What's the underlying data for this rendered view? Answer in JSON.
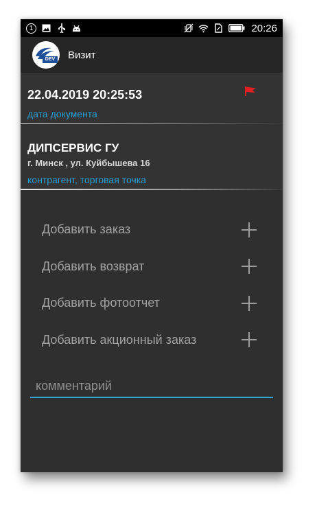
{
  "status_bar": {
    "notification_count": "1",
    "icons_left": [
      "notification-count-icon",
      "image-icon",
      "usb-icon",
      "android-debug-icon"
    ],
    "icons_right": [
      "vibrate-off-icon",
      "wifi-icon",
      "no-sim-icon",
      "battery-icon"
    ],
    "time": "20:26"
  },
  "app_bar": {
    "logo_text": "DEV",
    "title": "Визит"
  },
  "document": {
    "date": "22.04.2019 20:25:53",
    "label": "дата документа",
    "flag_icon": "flag-icon",
    "flag_color": "#e02020"
  },
  "counterparty": {
    "name": "ДИПСЕРВИС  ГУ",
    "address": "г. Минск , ул. Куйбышева 16",
    "label": "контрагент, торговая точка"
  },
  "actions": [
    {
      "label": "Добавить заказ",
      "icon": "plus-icon"
    },
    {
      "label": "Добавить возврат",
      "icon": "plus-icon"
    },
    {
      "label": "Добавить фотоотчет",
      "icon": "plus-icon"
    },
    {
      "label": "Добавить акционный заказ",
      "icon": "plus-icon"
    }
  ],
  "comment": {
    "placeholder": "комментарий",
    "value": ""
  },
  "colors": {
    "accent": "#27a0d8",
    "background": "#2f2f2f",
    "app_bar": "#262626"
  }
}
